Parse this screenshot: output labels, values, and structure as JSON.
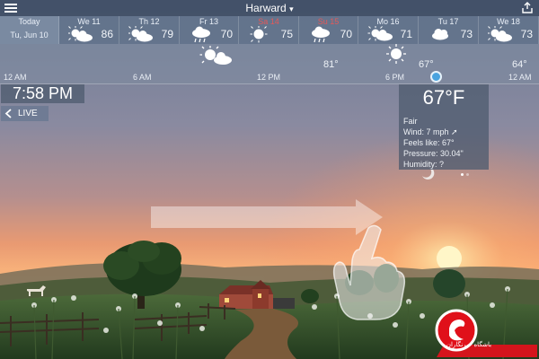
{
  "header": {
    "location": "Harward",
    "caret": "▾"
  },
  "forecast_days": [
    {
      "label": "Today",
      "sub": "Tu, Jun 10",
      "temp": "",
      "icon": "none",
      "color": "normal"
    },
    {
      "label": "We 11",
      "sub": "",
      "temp": "86",
      "icon": "partly-cloudy-icon",
      "color": "normal"
    },
    {
      "label": "Th 12",
      "sub": "",
      "temp": "79",
      "icon": "partly-cloudy-icon",
      "color": "normal"
    },
    {
      "label": "Fr 13",
      "sub": "",
      "temp": "70",
      "icon": "rain-icon",
      "color": "normal"
    },
    {
      "label": "Sa 14",
      "sub": "",
      "temp": "75",
      "icon": "sun-icon",
      "color": "red"
    },
    {
      "label": "Su 15",
      "sub": "",
      "temp": "70",
      "icon": "rain-icon",
      "color": "red"
    },
    {
      "label": "Mo 16",
      "sub": "",
      "temp": "71",
      "icon": "sun-cloud-icon",
      "color": "normal"
    },
    {
      "label": "Tu 17",
      "sub": "",
      "temp": "73",
      "icon": "cloud-icon",
      "color": "normal"
    },
    {
      "label": "We 18",
      "sub": "",
      "temp": "73",
      "icon": "partly-cloudy-icon",
      "color": "normal"
    }
  ],
  "hourly": {
    "time_labels": [
      "12 AM",
      "6 AM",
      "12 PM",
      "6 PM",
      "12 AM"
    ],
    "temps": [
      "81°",
      "67°",
      "64°"
    ],
    "icons": [
      "sun-cloud-icon",
      "sun-icon"
    ],
    "marker_color": "#4aa3df"
  },
  "time": "7:58 PM",
  "live_label": "LIVE",
  "current": {
    "temp": "67°F",
    "condition": "Fair",
    "wind": "Wind:  7 mph ➚",
    "feels_like": "Feels like: 67°",
    "pressure": "Pressure: 30.04\"",
    "humidity": "Humidity:  ?"
  },
  "watermark": {
    "text": "باشگاه خبرنگاران",
    "color": "#e0101a"
  },
  "colors": {
    "sky_top": "#6e7d96",
    "sky_glow": "#f08a5a",
    "sun": "#fff3c2",
    "hill_dark": "#1f3a22",
    "accent_red": "#e35959"
  }
}
